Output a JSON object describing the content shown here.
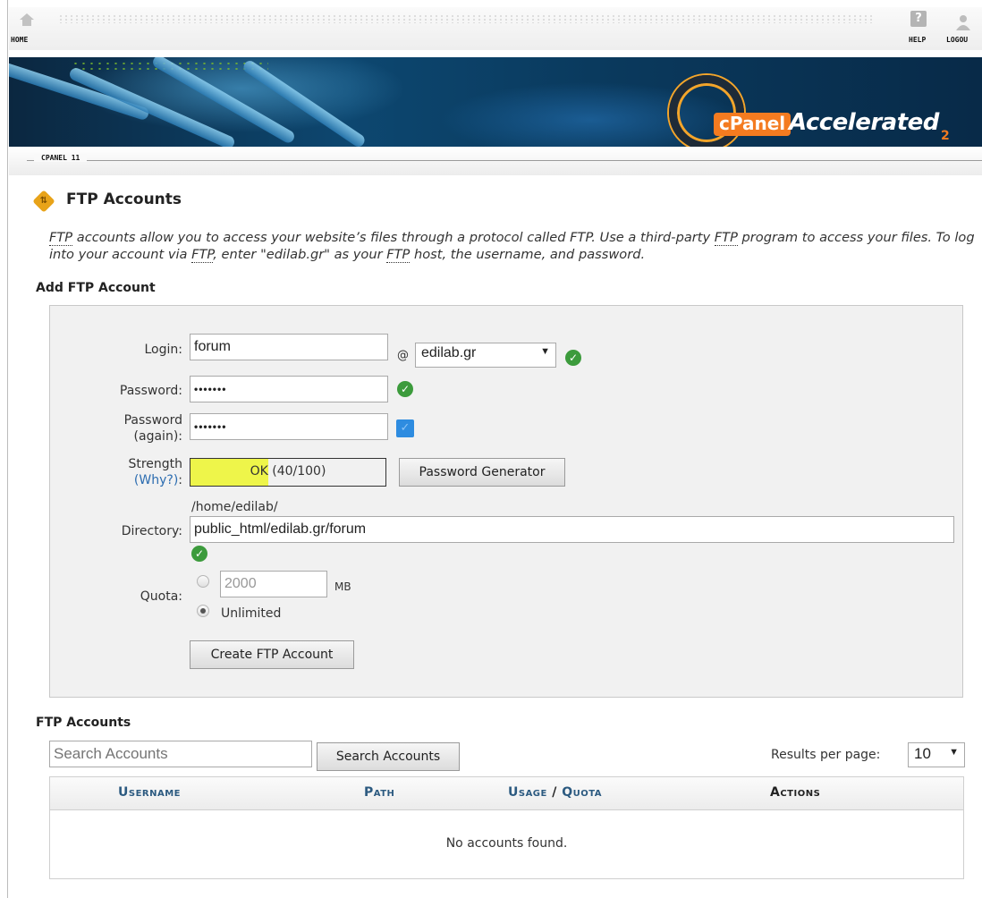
{
  "topnav": {
    "home_label": "HOME",
    "help_label": "HELP",
    "help_glyph": "?",
    "logout_label": "LOGOU"
  },
  "banner": {
    "logo_text": "cPanel",
    "logo_tagline": "Accelerated",
    "logo_sub": "2"
  },
  "breadcrumb": {
    "label": "CPANEL 11"
  },
  "page": {
    "title": "FTP Accounts",
    "description_parts": {
      "ftp": "FTP",
      "p1": " accounts allow you to access your website’s files through a protocol called FTP. Use a third-party ",
      "p2": " program to access your files. To log into your account via ",
      "p3": ", enter \"edilab.gr\" as your ",
      "p4": " host, the username, and password."
    }
  },
  "add_form": {
    "section_title": "Add FTP Account",
    "login_label": "Login:",
    "login_value": "forum",
    "at_sign": "@",
    "domain_value": "edilab.gr",
    "password_label": "Password:",
    "password_value": "•••••••",
    "password_again_label_1": "Password",
    "password_again_label_2": "(again):",
    "password_again_value": "•••••••",
    "strength_label": "Strength",
    "why_label": "(Why?)",
    "why_colon": ":",
    "strength_ok": "OK",
    "strength_score": "(40/100)",
    "strength_fraction": 0.4,
    "password_generator_label": "Password Generator",
    "directory_prefix": "/home/edilab/",
    "directory_label": "Directory:",
    "directory_value": "public_html/edilab.gr/forum",
    "quota_label": "Quota:",
    "quota_value": "2000",
    "quota_unit": "MB",
    "unlimited_label": "Unlimited",
    "create_button": "Create FTP Account"
  },
  "accounts": {
    "section_title": "FTP Accounts",
    "search_placeholder": "Search Accounts",
    "search_button": "Search Accounts",
    "results_per_page_label": "Results per page:",
    "results_per_page_value": "10",
    "columns": {
      "username": "Username",
      "path": "Path",
      "usage": "Usage",
      "slash": " / ",
      "quota": "Quota",
      "actions": "Actions"
    },
    "empty_message": "No accounts found."
  },
  "colors": {
    "brand_orange": "#f47b20",
    "link_blue": "#2b6cb0",
    "strength_yellow": "#eef54a",
    "ok_green": "#3c9b3c"
  }
}
